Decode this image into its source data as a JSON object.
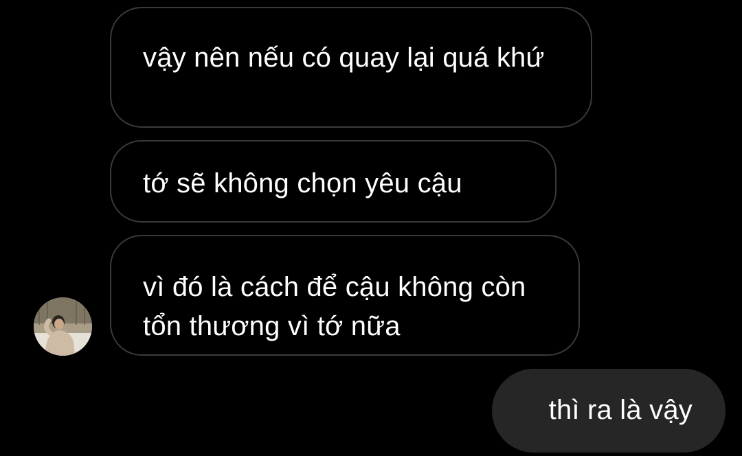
{
  "thread": {
    "messages": [
      {
        "sender": "other",
        "text": "vậy nên nếu có quay lại quá khứ"
      },
      {
        "sender": "other",
        "text": "tớ sẽ không chọn yêu cậu"
      },
      {
        "sender": "other",
        "text": "vì đó là cách để cậu không còn tổn thương vì tớ nữa"
      },
      {
        "sender": "me",
        "text": "thì ra là vậy"
      }
    ]
  },
  "colors": {
    "background": "#000000",
    "incoming_border": "#3a3a3a",
    "outgoing_bubble": "#262626",
    "text": "#ffffff"
  },
  "icons": {
    "avatar": "contact-avatar-photo"
  }
}
